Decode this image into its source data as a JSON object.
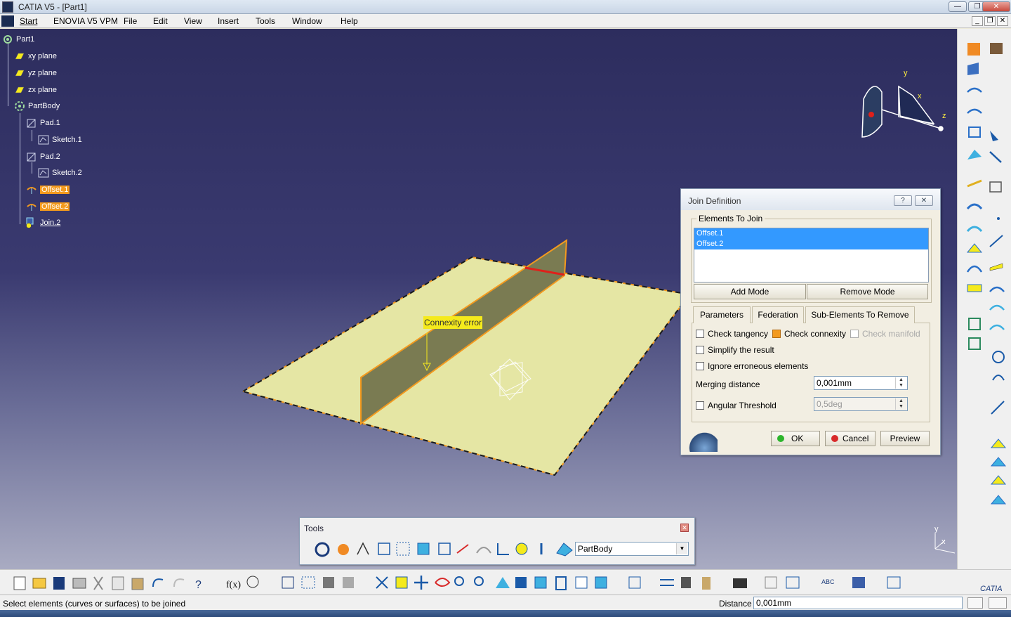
{
  "window": {
    "title": "CATIA V5 - [Part1]"
  },
  "menu": {
    "items": [
      "Start",
      "ENOVIA V5 VPM",
      "File",
      "Edit",
      "View",
      "Insert",
      "Tools",
      "Window",
      "Help"
    ]
  },
  "tree": {
    "root": "Part1",
    "xy": "xy plane",
    "yz": "yz plane",
    "zx": "zx plane",
    "body": "PartBody",
    "pad1": "Pad.1",
    "sketch1": "Sketch.1",
    "pad2": "Pad.2",
    "sketch2": "Sketch.2",
    "offset1": "Offset.1",
    "offset2": "Offset.2",
    "join2": "Join.2"
  },
  "viewport": {
    "error_label": "Connexity error",
    "compass_y": "y",
    "compass_x": "x",
    "compass_z": "z",
    "axis_y": "y",
    "axis_x": "x",
    "colors": {
      "surface": "#e5e6a4",
      "wall": "#7a7b52",
      "edge": "#f39a1e",
      "error_edge": "#e0201a"
    }
  },
  "dialog": {
    "title": "Join Definition",
    "help_btn": "?",
    "close_btn": "✕",
    "elements_group": "Elements To Join",
    "elements": [
      "Offset.1",
      "Offset.2"
    ],
    "add_mode": "Add Mode",
    "remove_mode": "Remove Mode",
    "tabs": [
      "Parameters",
      "Federation",
      "Sub-Elements To Remove"
    ],
    "check_tangency": "Check tangency",
    "check_connexity": "Check connexity",
    "check_manifold": "Check manifold",
    "simplify": "Simplify the result",
    "ignore_erroneous": "Ignore erroneous elements",
    "merging_label": "Merging distance",
    "merging_value": "0,001mm",
    "angular_label": "Angular Threshold",
    "angular_value": "0,5deg",
    "ok": "OK",
    "cancel": "Cancel",
    "preview": "Preview"
  },
  "tools_toolbar": {
    "title": "Tools",
    "body_select": "PartBody"
  },
  "status": {
    "message": "Select elements (curves or surfaces) to be joined",
    "distance_label": "Distance",
    "distance_value": "0,001mm"
  }
}
